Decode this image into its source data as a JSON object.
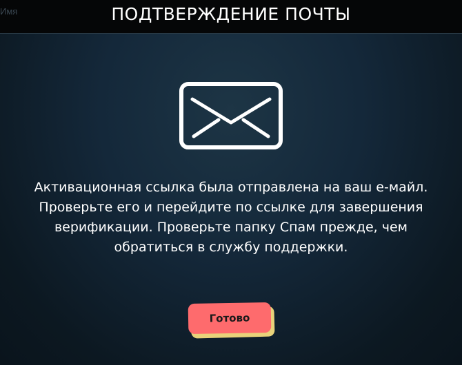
{
  "header": {
    "background_field_label": "Имя",
    "title": "ПОДТВЕРЖДЕНИЕ ПОЧТЫ"
  },
  "icon": {
    "name": "envelope-icon",
    "color": "#ffffff"
  },
  "message": {
    "lines": [
      "Активационная ссылка была отправлена на ваш е-майл.",
      "Проверьте его и перейдите по ссылке для завершения",
      "верификации. Проверьте папку Спам прежде, чем",
      "обратиться в службу поддержки."
    ]
  },
  "button": {
    "label": "Готово",
    "color": "#fe6b6d",
    "shadow_color": "#e8d27a"
  },
  "colors": {
    "background": "#14283a",
    "header": "#050607",
    "text": "#ffffff"
  }
}
